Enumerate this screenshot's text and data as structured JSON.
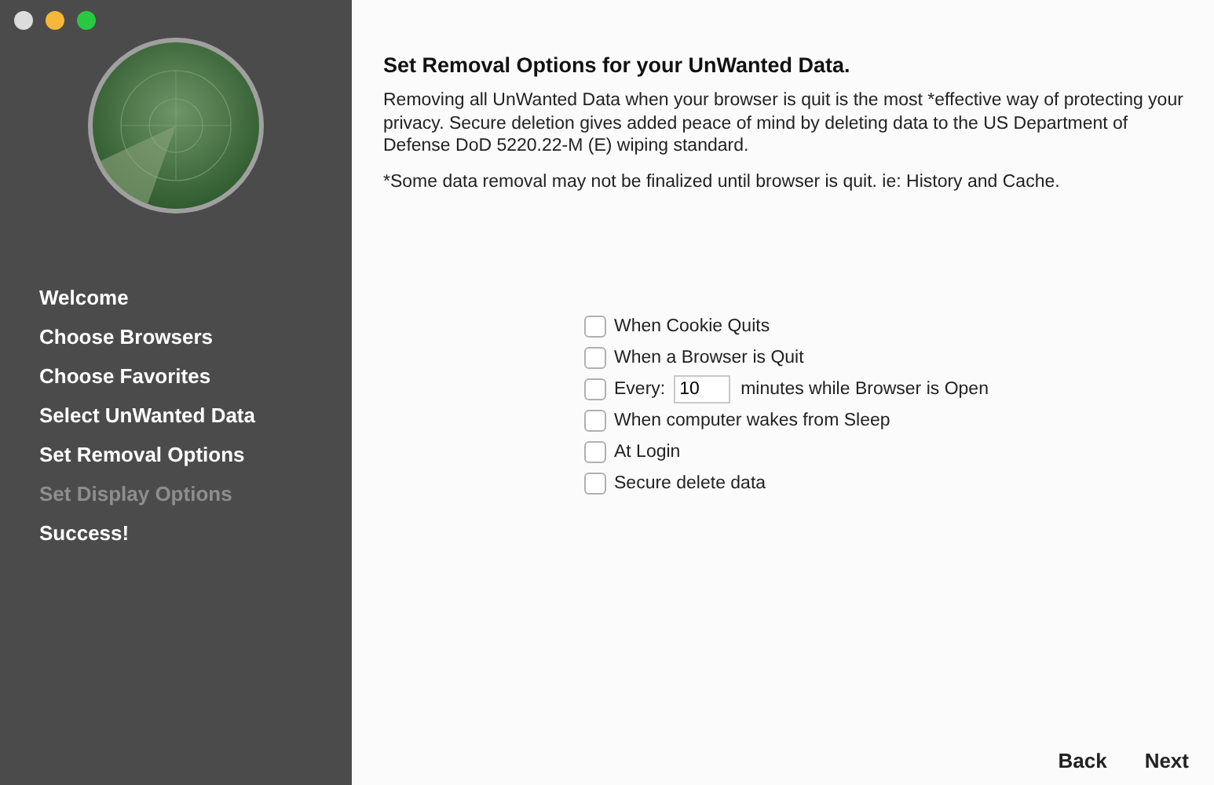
{
  "sidebar": {
    "items": [
      {
        "label": "Welcome",
        "disabled": false
      },
      {
        "label": "Choose Browsers",
        "disabled": false
      },
      {
        "label": "Choose Favorites",
        "disabled": false
      },
      {
        "label": "Select UnWanted Data",
        "disabled": false
      },
      {
        "label": "Set Removal Options",
        "disabled": false
      },
      {
        "label": "Set Display Options",
        "disabled": true
      },
      {
        "label": "Success!",
        "disabled": false
      }
    ]
  },
  "heading": "Set Removal Options for your UnWanted Data.",
  "description": "Removing all UnWanted Data when your browser is quit is the most *effective way of protecting your privacy. Secure deletion gives added peace of mind by deleting data to the US Department of Defense DoD 5220.22-M (E) wiping standard.",
  "note": "*Some data removal may not be finalized until browser is quit. ie: History and Cache.",
  "options": [
    {
      "kind": "checkbox",
      "label": "When Cookie Quits",
      "checked": false
    },
    {
      "kind": "checkbox",
      "label": "When a Browser is Quit",
      "checked": false
    },
    {
      "kind": "interval",
      "label": "Every:",
      "value": "10",
      "suffix": "minutes while Browser is Open",
      "checked": false
    },
    {
      "kind": "checkbox",
      "label": "When computer wakes from Sleep",
      "checked": false
    },
    {
      "kind": "checkbox",
      "label": "At Login",
      "checked": false
    },
    {
      "kind": "checkbox",
      "label": "Secure delete data",
      "checked": false
    }
  ],
  "buttons": [
    "Back",
    "Next"
  ]
}
